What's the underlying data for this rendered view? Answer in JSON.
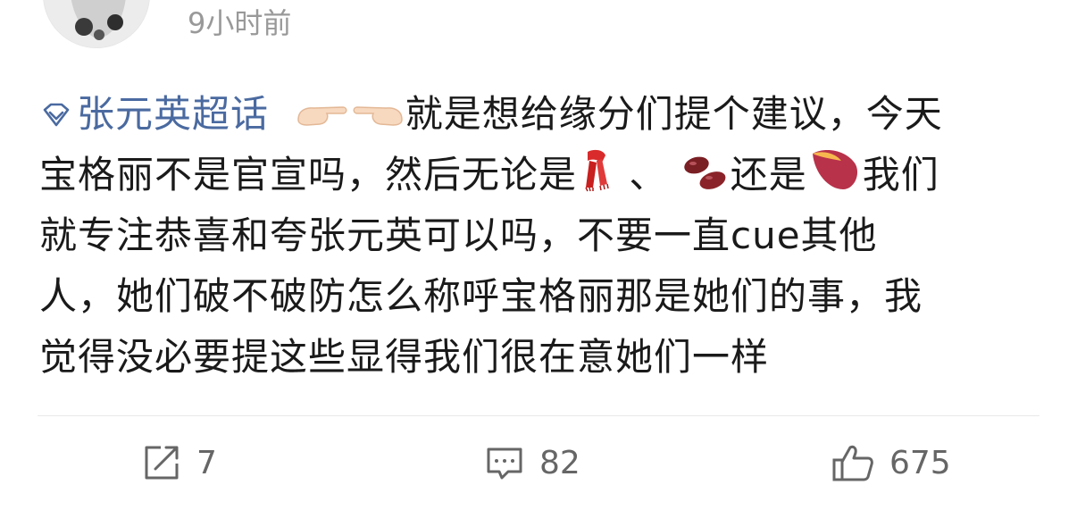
{
  "post": {
    "timestamp": "9小时前",
    "topic": "张元英超话",
    "text_lines": [
      "就是想给缘分们提个建议，今天",
      "宝格丽不是官宣吗，然后无论是",
      "、",
      "还是",
      "我们",
      "就专注恭喜和夸张元英可以吗，不要一直cue其他",
      "人，她们破不破防怎么称呼宝格丽那是她们的事，我",
      "觉得没必要提这些显得我们很在意她们一样"
    ],
    "emojis": [
      "backhand-index-pointing-right",
      "backhand-index-pointing-left",
      "scarf",
      "beans",
      "roasted-sweet-potato"
    ]
  },
  "actions": {
    "repost_count": "7",
    "comment_count": "82",
    "like_count": "675"
  },
  "icons": {
    "repost": "repost-icon",
    "comment": "comment-icon",
    "like": "thumbs-up-icon",
    "topic": "super-topic-diamond-icon"
  },
  "colors": {
    "topic_link": "#4a6aa0",
    "timestamp": "#999999",
    "action_text": "#666666",
    "divider": "#e8e8e8"
  }
}
